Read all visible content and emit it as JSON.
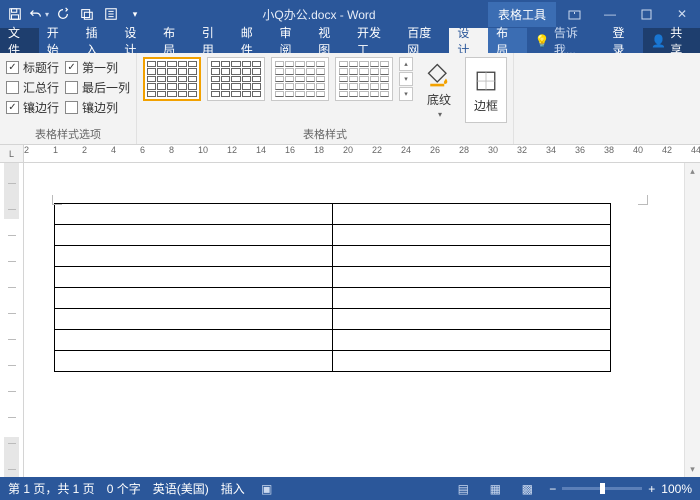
{
  "title": "小Q办公.docx - Word",
  "tableTools": "表格工具",
  "tabs": {
    "file": "文件",
    "home": "开始",
    "insert": "插入",
    "design": "设计",
    "layout": "布局",
    "references": "引用",
    "mailings": "邮件",
    "review": "审阅",
    "view": "视图",
    "dev": "开发工",
    "baidu": "百度网",
    "tdesign": "设计",
    "tlayout": "布局"
  },
  "tellme": "告诉我...",
  "login": "登录",
  "share": "共享",
  "opts": {
    "headerRow": "标题行",
    "firstCol": "第一列",
    "totalRow": "汇总行",
    "lastCol": "最后一列",
    "bandedRow": "镶边行",
    "bandedCol": "镶边列"
  },
  "groups": {
    "styleOptions": "表格样式选项",
    "styles": "表格样式"
  },
  "shading": "底纹",
  "borders": "边框",
  "ruler": [
    "2",
    "1",
    "2",
    "4",
    "6",
    "8",
    "10",
    "12",
    "14",
    "16",
    "18",
    "20",
    "22",
    "24",
    "26",
    "28",
    "30",
    "32",
    "34",
    "36",
    "38",
    "40",
    "42",
    "44"
  ],
  "status": {
    "page": "第 1 页，共 1 页",
    "words": "0 个字",
    "lang": "英语(美国)",
    "mode": "插入"
  },
  "zoom": "100%"
}
